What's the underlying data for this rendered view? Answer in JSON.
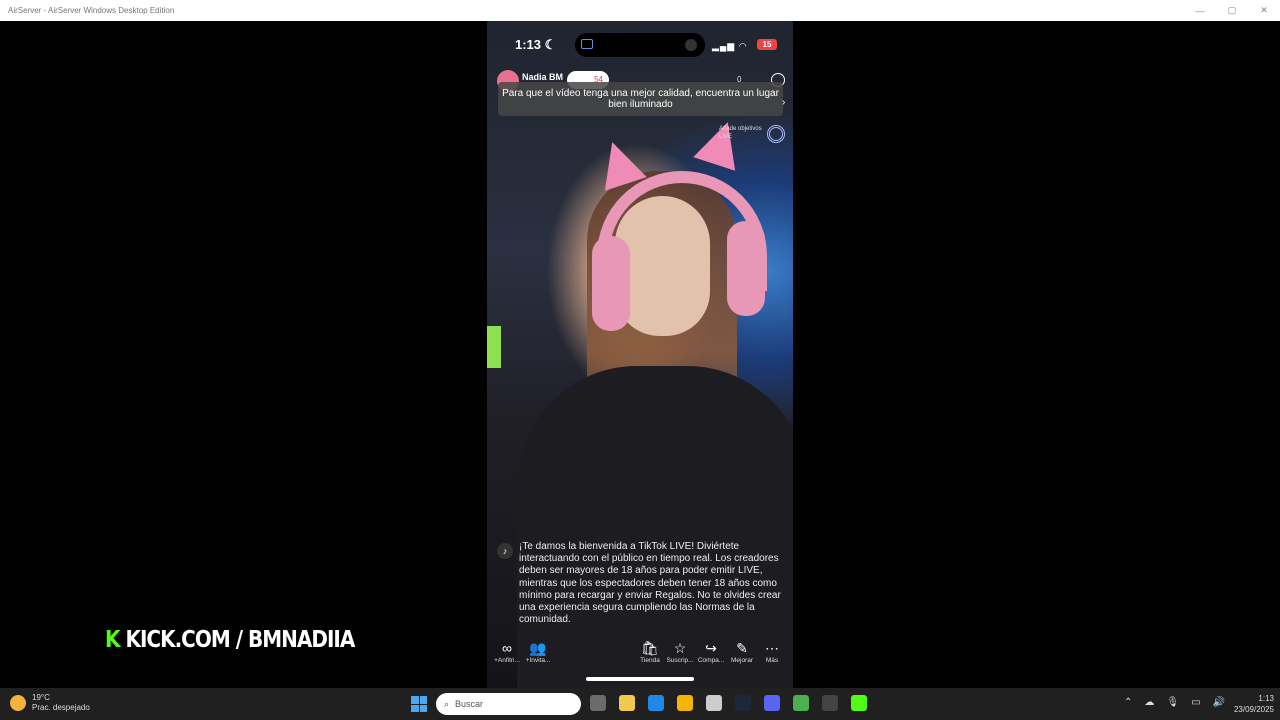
{
  "window": {
    "title": "AirServer - AirServer Windows Desktop Edition",
    "minimize": "—",
    "maximize": "▢",
    "close": "✕"
  },
  "phone": {
    "status": {
      "time": "1:13",
      "moon": "☾",
      "signal": "▂▄▆",
      "wifi": "◠",
      "battery": "15"
    },
    "host": {
      "name": "Nadia BM",
      "likes": "54"
    },
    "viewers": "0",
    "tip": "Para que el vídeo tenga una mejor calidad, encuentra un lugar bien iluminado",
    "tip_arrow": "›",
    "goals": "Añade objetivos LIVE",
    "welcome": "¡Te damos la bienvenida a TikTok LIVE! Diviértete interactuando con el público en tiempo real. Los creadores deben ser mayores de 18 años para poder emitir LIVE, mientras que los espectadores deben tener 18 años como mínimo para recargar y enviar Regalos. No te olvides crear una experiencia segura cumpliendo las Normas de la comunidad.",
    "welcome_logo": "♪",
    "bottom": {
      "items": [
        {
          "label": "+Anfitri...",
          "icon": "∞"
        },
        {
          "label": "+Invita...",
          "icon": "👥"
        },
        {
          "label": "Tienda",
          "icon": "🛍"
        },
        {
          "label": "Suscrip...",
          "icon": "☆"
        },
        {
          "label": "Compa...",
          "icon": "↪"
        },
        {
          "label": "Mejorar",
          "icon": "✎"
        },
        {
          "label": "Más",
          "icon": "⋯"
        }
      ]
    }
  },
  "overlay": {
    "kick_k": "K",
    "kick_text": "KICK.COM / BMNADIIA"
  },
  "taskbar": {
    "weather": {
      "temp": "19°C",
      "desc": "Prac. despejado"
    },
    "search_placeholder": "Buscar",
    "search_icon": "⌕",
    "tray": {
      "chevron": "⌃",
      "cloud": "☁",
      "mic": "🎙",
      "display": "▭",
      "volume": "🔊"
    },
    "time": "1:13",
    "date": "23/09/2025",
    "app_colors": [
      "#6b6b6b",
      "#f2c94c",
      "#1e88e5",
      "#f4b400",
      "#cccccc",
      "#1b2838",
      "#5865f2",
      "#4caf50",
      "#444444",
      "#53fc18"
    ]
  }
}
